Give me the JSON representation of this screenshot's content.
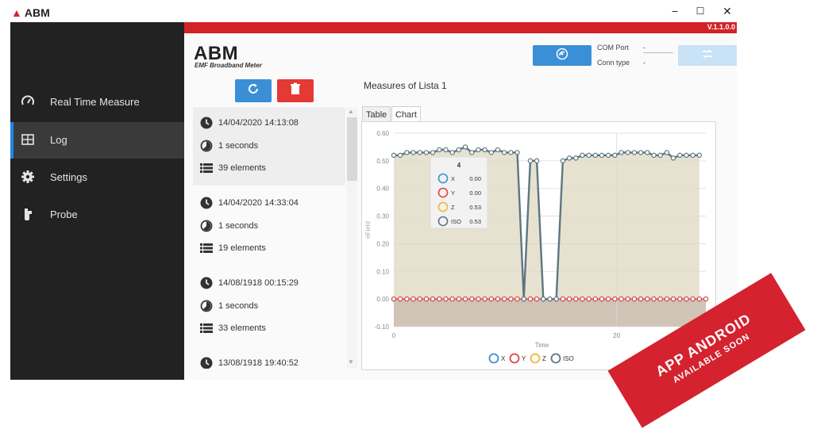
{
  "window": {
    "app_name": "ABM",
    "minimize": "−",
    "maximize": "☐",
    "close": "✕",
    "version": "V.1.1.0.0"
  },
  "sidebar": {
    "items": [
      {
        "label": "Real Time Measure",
        "icon": "speedometer-icon",
        "active": false
      },
      {
        "label": "Log",
        "icon": "table-icon",
        "active": true
      },
      {
        "label": "Settings",
        "icon": "gear-icon",
        "active": false
      },
      {
        "label": "Probe",
        "icon": "probe-icon",
        "active": false
      }
    ]
  },
  "header": {
    "brand": "ABM",
    "subtitle": "EMF Broadband Meter",
    "com_port_label": "COM Port",
    "com_port_value": "-",
    "conn_type_label": "Conn type",
    "conn_type_value": "-"
  },
  "log": {
    "entries": [
      {
        "datetime": "14/04/2020 14:13:08",
        "duration": "1 seconds",
        "count": "39 elements"
      },
      {
        "datetime": "14/04/2020 14:33:04",
        "duration": "1 seconds",
        "count": "19 elements"
      },
      {
        "datetime": "14/08/1918 00:15:29",
        "duration": "1 seconds",
        "count": "33 elements"
      },
      {
        "datetime": "13/08/1918 19:40:52"
      }
    ]
  },
  "measures": {
    "title": "Measures of Lista 1",
    "tabs": [
      "Table",
      "Chart"
    ]
  },
  "tooltip": {
    "index": "4",
    "rows": [
      {
        "name": "X",
        "value": "0.00",
        "color": "#3d8fd1"
      },
      {
        "name": "Y",
        "value": "0.00",
        "color": "#e04545"
      },
      {
        "name": "Z",
        "value": "0.53",
        "color": "#f2b632"
      },
      {
        "name": "ISO",
        "value": "0.53",
        "color": "#5c7683"
      }
    ]
  },
  "chart_data": {
    "type": "line",
    "xlabel": "Time",
    "ylabel": "eField",
    "ylim": [
      -0.1,
      0.6
    ],
    "xlim": [
      0,
      28
    ],
    "yticks": [
      "0.60",
      "0.50",
      "0.40",
      "0.30",
      "0.20",
      "0.10",
      "0.00",
      "-0.10"
    ],
    "xticks": [
      "0",
      "20"
    ],
    "legend_position": "bottom",
    "grid": true,
    "series": [
      {
        "name": "X",
        "color": "#3d8fd1",
        "values": [
          0.0,
          0.0,
          0.0,
          0.0,
          0.0,
          0.0,
          0.0,
          0.0,
          0.0,
          0.0,
          0.0,
          0.0,
          0.0,
          0.0,
          0.0,
          0.0,
          0.0,
          0.0,
          0.0,
          0.0,
          0.0,
          0.0,
          0.0,
          0.0,
          0.0,
          0.0,
          0.0,
          0.0,
          0.0,
          0.0,
          0.0,
          0.0,
          0.0,
          0.0,
          0.0,
          0.0,
          0.0,
          0.0,
          0.0,
          0.0,
          0.0,
          0.0,
          0.0,
          0.0,
          0.0,
          0.0,
          0.0,
          0.0,
          0.0
        ]
      },
      {
        "name": "Y",
        "color": "#e04545",
        "values": [
          0.0,
          0.0,
          0.0,
          0.0,
          0.0,
          0.0,
          0.0,
          0.0,
          0.0,
          0.0,
          0.0,
          0.0,
          0.0,
          0.0,
          0.0,
          0.0,
          0.0,
          0.0,
          0.0,
          0.0,
          0.0,
          0.0,
          0.0,
          0.0,
          0.0,
          0.0,
          0.0,
          0.0,
          0.0,
          0.0,
          0.0,
          0.0,
          0.0,
          0.0,
          0.0,
          0.0,
          0.0,
          0.0,
          0.0,
          0.0,
          0.0,
          0.0,
          0.0,
          0.0,
          0.0,
          0.0,
          0.0,
          0.0,
          0.0
        ]
      },
      {
        "name": "Z",
        "color": "#f2b632",
        "values": [
          0.52,
          0.52,
          0.53,
          0.53,
          0.53,
          0.53,
          0.53,
          0.54,
          0.54,
          0.53,
          0.54,
          0.55,
          0.53,
          0.54,
          0.54,
          0.53,
          0.54,
          0.53,
          0.53,
          0.53,
          0.0,
          0.5,
          0.5,
          0.0,
          0.0,
          0.0,
          0.5,
          0.51,
          0.51,
          0.52,
          0.52,
          0.52,
          0.52,
          0.52,
          0.52,
          0.53,
          0.53,
          0.53,
          0.53,
          0.53,
          0.52,
          0.52,
          0.53,
          0.51,
          0.52,
          0.52,
          0.52,
          0.52
        ]
      },
      {
        "name": "ISO",
        "color": "#5c7683",
        "values": [
          0.52,
          0.52,
          0.53,
          0.53,
          0.53,
          0.53,
          0.53,
          0.54,
          0.54,
          0.53,
          0.54,
          0.55,
          0.53,
          0.54,
          0.54,
          0.53,
          0.54,
          0.53,
          0.53,
          0.53,
          0.0,
          0.5,
          0.5,
          0.0,
          0.0,
          0.0,
          0.5,
          0.51,
          0.51,
          0.52,
          0.52,
          0.52,
          0.52,
          0.52,
          0.52,
          0.53,
          0.53,
          0.53,
          0.53,
          0.53,
          0.52,
          0.52,
          0.53,
          0.51,
          0.52,
          0.52,
          0.52,
          0.52
        ]
      }
    ]
  },
  "banner": {
    "line1": "APP ANDROID",
    "line2": "AVAILABLE SOON",
    "color": "#d4222f"
  }
}
